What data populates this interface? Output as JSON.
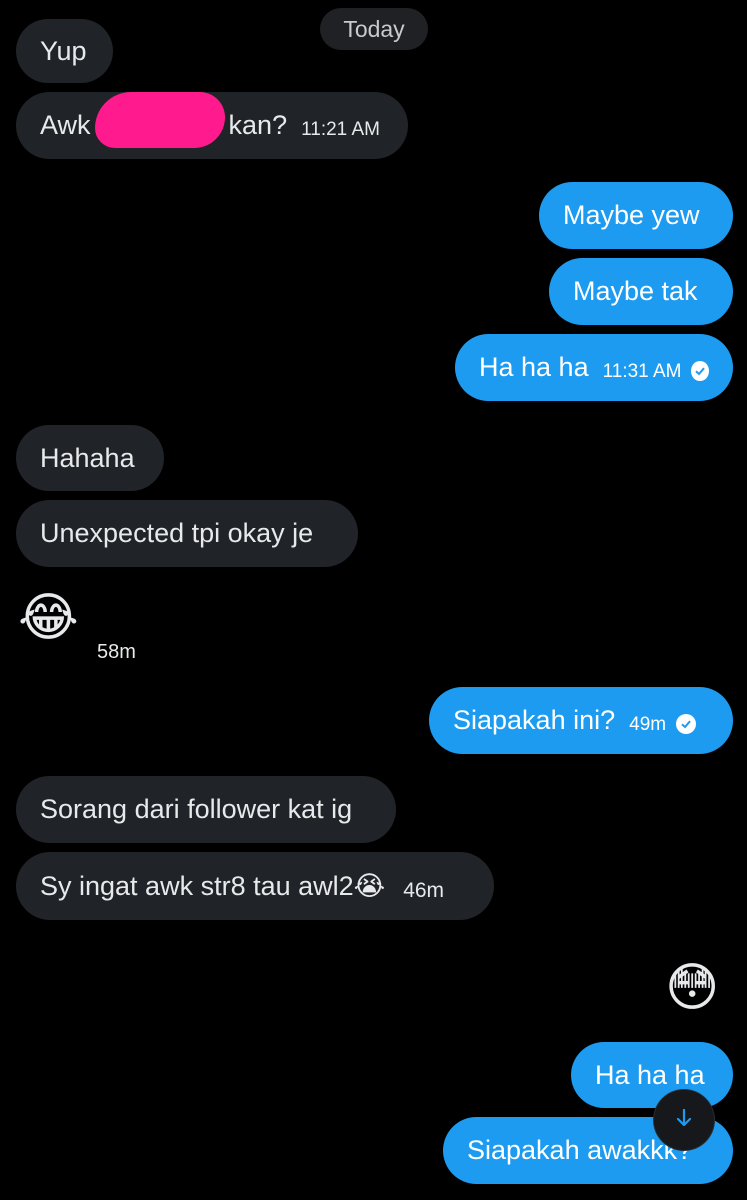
{
  "date_divider": "Today",
  "messages": [
    {
      "text": "Yup"
    },
    {
      "text_before": "Awk",
      "text_after": "kan?",
      "time": "11:21 AM"
    },
    {
      "text": "Maybe yew"
    },
    {
      "text": "Maybe tak"
    },
    {
      "text": "Ha ha ha",
      "time": "11:31 AM"
    },
    {
      "text": "Hahaha"
    },
    {
      "text": "Unexpected tpi okay je"
    },
    {
      "emoji": "😂",
      "time": "58m"
    },
    {
      "text": "Siapakah ini?",
      "time": "49m"
    },
    {
      "text": "Sorang dari follower kat ig"
    },
    {
      "text": "Sy ingat awk str8 tau awl2😭",
      "time": "46m"
    },
    {
      "emoji": "😳"
    },
    {
      "text": "Ha ha ha"
    },
    {
      "text": "Siapakah awakkk?"
    }
  ],
  "colors": {
    "background": "#000000",
    "received_bubble": "#202327",
    "sent_bubble": "#1d9bf0",
    "redaction": "#ff1b8d"
  },
  "icons": {
    "read_receipt": "check-circle-icon",
    "scroll_down": "arrow-down-icon"
  }
}
